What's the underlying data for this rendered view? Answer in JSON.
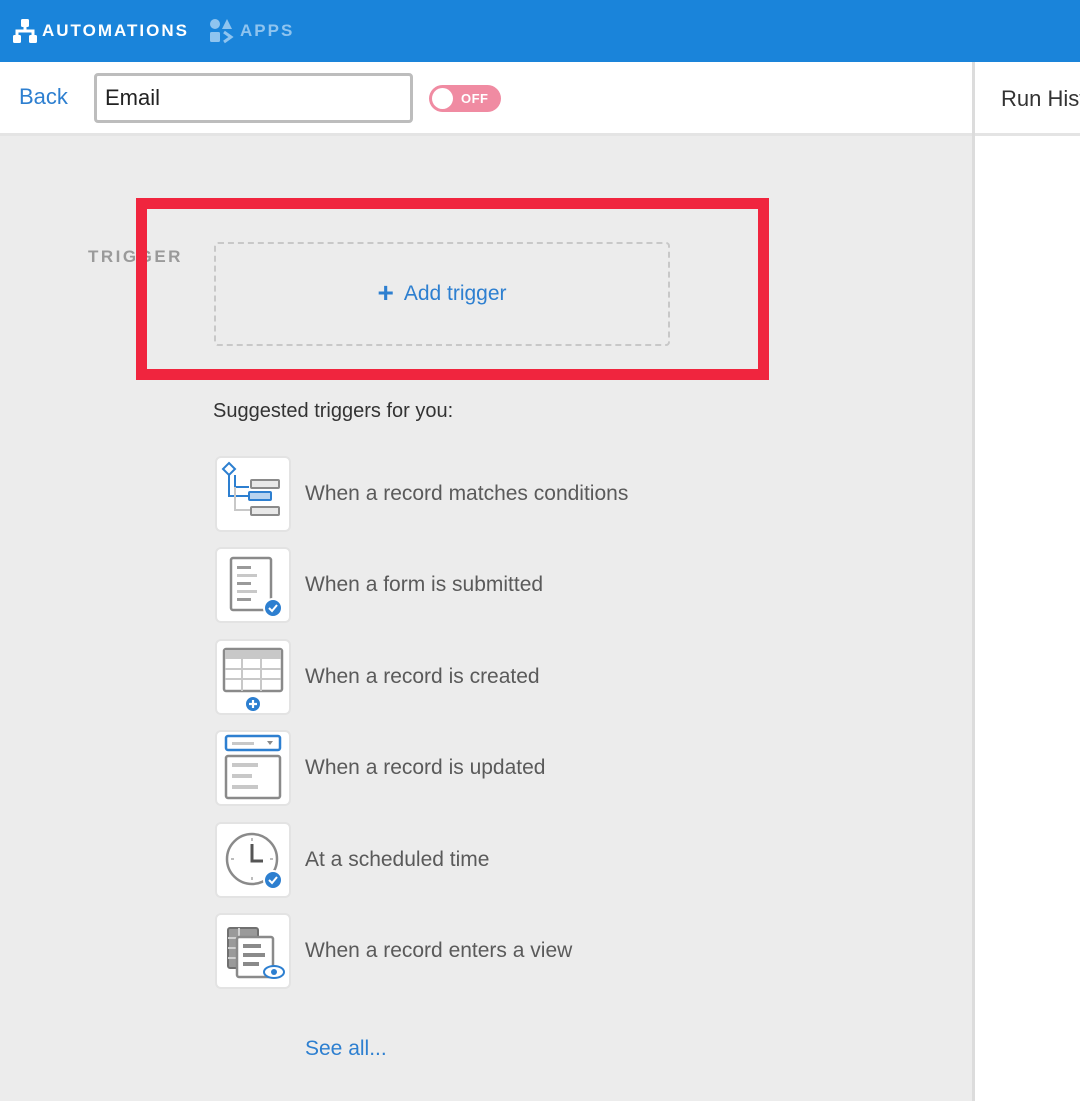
{
  "nav": {
    "automations_label": "AUTOMATIONS",
    "apps_label": "APPS"
  },
  "header": {
    "back_label": "Back",
    "automation_name": "Email",
    "toggle_label": "OFF",
    "run_history_label": "Run Hist"
  },
  "trigger": {
    "section_label": "TRIGGER",
    "add_trigger_label": "Add trigger"
  },
  "suggestions": {
    "heading": "Suggested triggers for you:",
    "items": [
      {
        "label": "When a record matches conditions",
        "icon": "conditions-tree-icon"
      },
      {
        "label": "When a form is submitted",
        "icon": "form-submitted-icon"
      },
      {
        "label": "When a record is created",
        "icon": "record-created-icon"
      },
      {
        "label": "When a record is updated",
        "icon": "record-updated-icon"
      },
      {
        "label": "At a scheduled time",
        "icon": "clock-scheduled-icon"
      },
      {
        "label": "When a record enters a view",
        "icon": "record-enters-view-icon"
      }
    ],
    "see_all_label": "See all..."
  },
  "colors": {
    "nav_bg": "#1a84da",
    "accent_blue": "#2d7fd0",
    "toggle_off": "#f08ba2",
    "highlight_red": "#f0253e"
  }
}
